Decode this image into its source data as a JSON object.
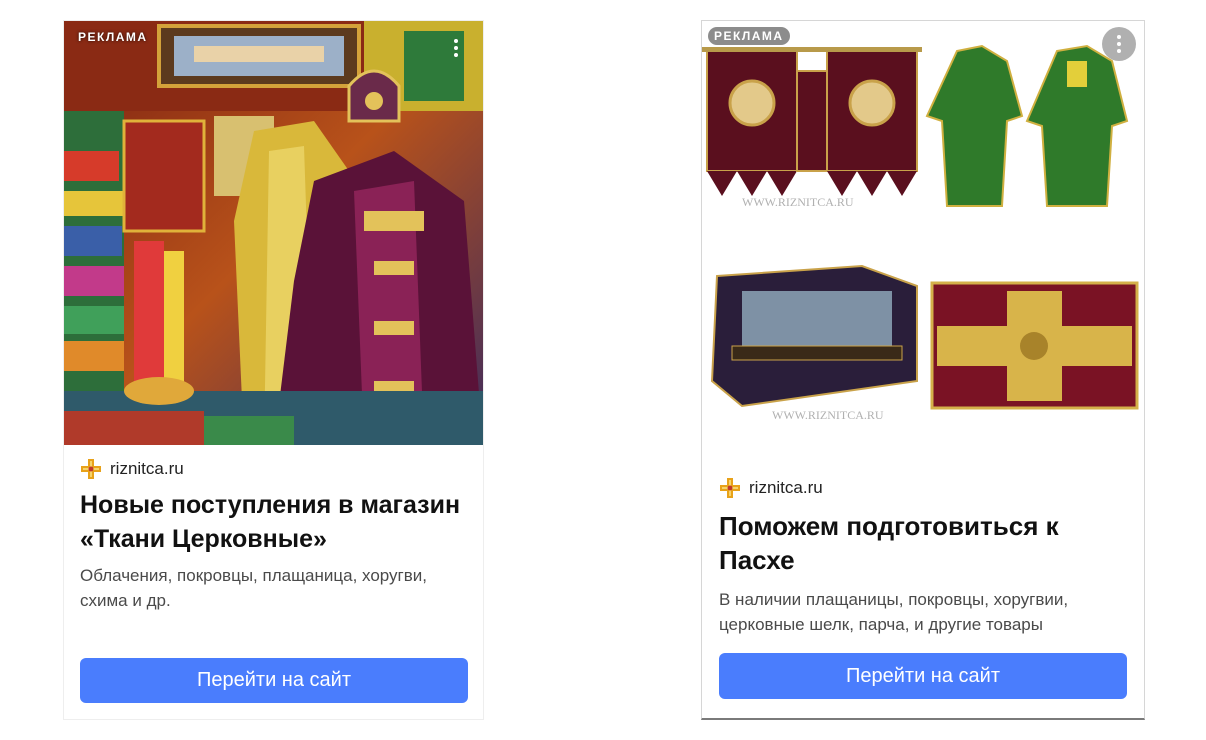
{
  "ads": [
    {
      "ad_label": "РЕКЛАМА",
      "domain": "riznitca.ru",
      "headline": "Новые поступления в магазин «Ткани Церковные»",
      "description": "Облачения, покровцы, плащаница, хоругви, схима и др.",
      "cta_label": "Перейти на сайт"
    },
    {
      "ad_label": "РЕКЛАМА",
      "domain": "riznitca.ru",
      "headline": "Поможем подготовиться к Пасхе",
      "description": "В наличии плащаницы, покровцы, хоругвии, церковные шелк, парча, и другие товары",
      "cta_label": "Перейти на сайт",
      "image_watermarks": [
        "WWW.RIZNITCA.RU",
        "WWW.RIZNITCA.RU"
      ]
    }
  ],
  "colors": {
    "cta_background": "#4a7dfd",
    "cta_text": "#ffffff",
    "favicon_primary": "#e8a21a"
  },
  "icons": {
    "favicon": "cross-favicon-icon",
    "more": "more-vertical-icon"
  }
}
